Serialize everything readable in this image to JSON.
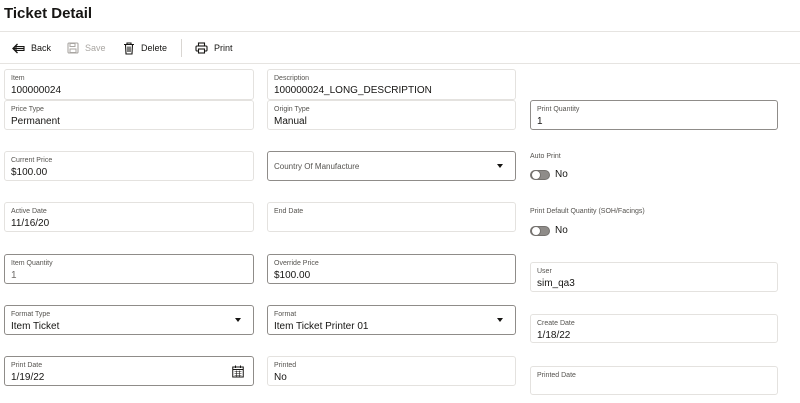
{
  "page": {
    "title": "Ticket Detail"
  },
  "toolbar": {
    "back": {
      "label": "Back",
      "icon": "back-arrow-icon",
      "enabled": true
    },
    "save": {
      "label": "Save",
      "icon": "save-icon",
      "enabled": false
    },
    "delete": {
      "label": "Delete",
      "icon": "trash-icon",
      "enabled": true
    },
    "print": {
      "label": "Print",
      "icon": "printer-icon",
      "enabled": true
    }
  },
  "form": {
    "item": {
      "label": "Item",
      "value": "100000024"
    },
    "description": {
      "label": "Description",
      "value": "100000024_LONG_DESCRIPTION"
    },
    "price_type": {
      "label": "Price Type",
      "value": "Permanent"
    },
    "origin_type": {
      "label": "Origin Type",
      "value": "Manual"
    },
    "print_quantity": {
      "label": "Print Quantity",
      "value": "1"
    },
    "current_price": {
      "label": "Current Price",
      "value": "$100.00"
    },
    "country_of_manufacture": {
      "placeholder": "Country Of Manufacture"
    },
    "auto_print": {
      "label": "Auto Print",
      "value": "No"
    },
    "active_date": {
      "label": "Active Date",
      "value": "11/16/20"
    },
    "end_date": {
      "label": "End Date",
      "value": ""
    },
    "print_default_quantity": {
      "label": "Print Default Quantity (SOH/Facings)",
      "value": "No"
    },
    "item_quantity": {
      "label": "Item Quantity",
      "value": "1"
    },
    "override_price": {
      "label": "Override Price",
      "value": "$100.00"
    },
    "user": {
      "label": "User",
      "value": "sim_qa3"
    },
    "format_type": {
      "label": "Format Type",
      "value": "Item Ticket"
    },
    "format": {
      "label": "Format",
      "value": "Item Ticket Printer 01"
    },
    "create_date": {
      "label": "Create Date",
      "value": "1/18/22"
    },
    "print_date": {
      "label": "Print Date",
      "value": "1/19/22"
    },
    "printed": {
      "label": "Printed",
      "value": "No"
    },
    "printed_date": {
      "label": "Printed Date",
      "value": ""
    }
  }
}
